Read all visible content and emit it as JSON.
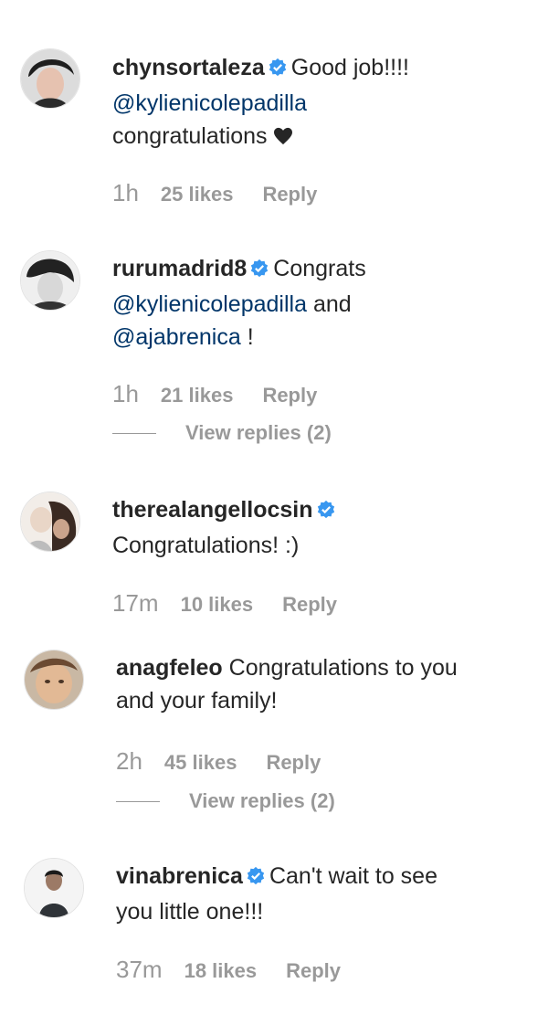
{
  "comments": [
    {
      "username": "chynsortaleza",
      "verified": true,
      "text_lines": [
        "Good job!!!!",
        "@kylienicolepadilla",
        "congratulations"
      ],
      "time": "1h",
      "likes": "25 likes",
      "reply": "Reply"
    },
    {
      "username": "rurumadrid8",
      "verified": true,
      "text_lines": [
        "Congrats",
        "@kylienicolepadilla",
        "and",
        "@ajabrenica",
        "!"
      ],
      "time": "1h",
      "likes": "21 likes",
      "reply": "Reply",
      "view_replies": "View replies (2)"
    },
    {
      "username": "therealangellocsin",
      "verified": true,
      "text_lines": [
        "Congratulations! :)"
      ],
      "time": "17m",
      "likes": "10 likes",
      "reply": "Reply"
    },
    {
      "username": "anagfeleo",
      "verified": false,
      "text_lines": [
        "Congratulations to you",
        "and your family!"
      ],
      "time": "2h",
      "likes": "45 likes",
      "reply": "Reply",
      "view_replies": "View replies (2)"
    },
    {
      "username": "vinabrenica",
      "verified": true,
      "text_lines": [
        "Can't wait to see",
        "you little one!!!"
      ],
      "time": "37m",
      "likes": "18 likes",
      "reply": "Reply"
    }
  ],
  "icons": {
    "verified": "verified-badge-icon",
    "heart": "black-heart-icon"
  },
  "colors": {
    "verified_blue": "#3897f0",
    "mention_blue": "#003569",
    "meta_gray": "#999999"
  }
}
